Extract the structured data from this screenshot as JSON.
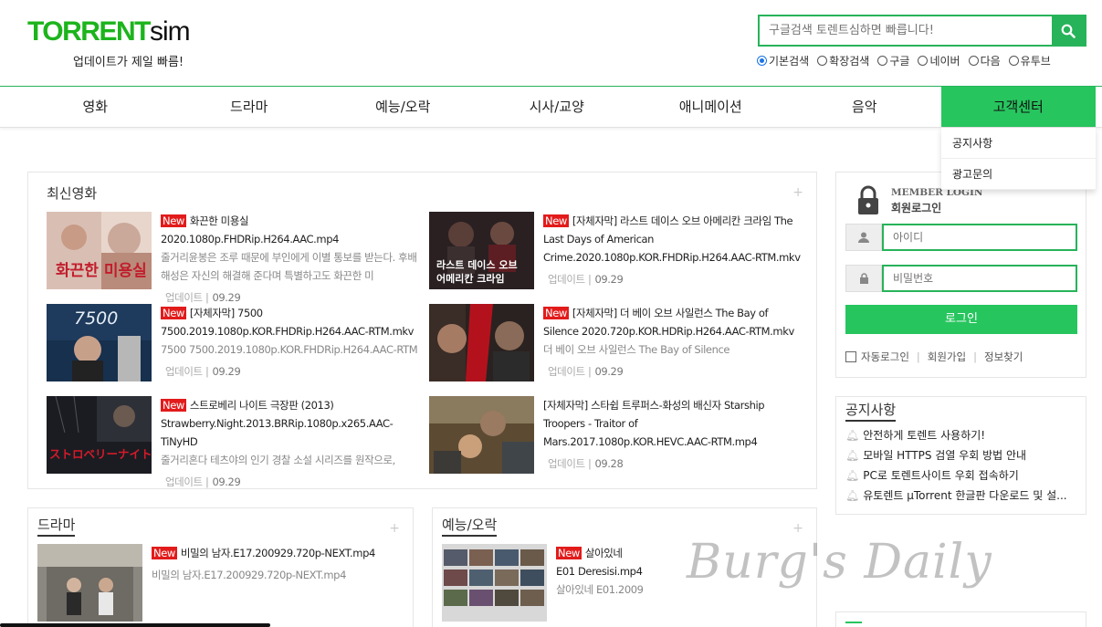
{
  "logo": {
    "part1": "TORRENT",
    "part2": "sim"
  },
  "tagline": "업데이트가 제일 빠름!",
  "search": {
    "placeholder": "구글검색 토렌트심하면 빠릅니다!"
  },
  "search_options": [
    {
      "label": "기본검색",
      "checked": true
    },
    {
      "label": "확장검색",
      "checked": false
    },
    {
      "label": "구글",
      "checked": false
    },
    {
      "label": "네이버",
      "checked": false
    },
    {
      "label": "다음",
      "checked": false
    },
    {
      "label": "유투브",
      "checked": false
    }
  ],
  "nav": [
    "영화",
    "드라마",
    "예능/오락",
    "시사/교양",
    "애니메이션",
    "음악",
    "고객센터"
  ],
  "dropdown": [
    "공지사항",
    "광고문의"
  ],
  "latest": {
    "title": "최신영화",
    "plus": "+",
    "items": [
      {
        "new": "New",
        "title": "화끈한 미용실 2020.1080p.FHDRip.H264.AAC.mp4",
        "desc": "줄거리윤봉은 조루 때문에 부인에게 이별 통보를 받는다. 후배 해성은 자신의 해결해 준다며 특별하고도 화끈한 미",
        "meta": "업데이트 |",
        "date": "09.29"
      },
      {
        "new": "New",
        "title": "[자체자막] 라스트 데이스 오브 아메리칸 크라임 The Last Days of American Crime.2020.1080p.KOR.FHDRip.H264.AAC-RTM.mkv",
        "desc": "",
        "meta": "업데이트 |",
        "date": "09.29"
      },
      {
        "new": "New",
        "title": "[자체자막] 7500 7500.2019.1080p.KOR.FHDRip.H264.AAC-RTM.mkv",
        "desc": "7500 7500.2019.1080p.KOR.FHDRip.H264.AAC-RTM",
        "meta": "업데이트 |",
        "date": "09.29"
      },
      {
        "new": "New",
        "title": "[자체자막] 더 베이 오브 사일런스 The Bay of Silence 2020.720p.KOR.HDRip.H264.AAC-RTM.mkv",
        "desc": "더 베이 오브 사일런스 The Bay of Silence",
        "meta": "업데이트 |",
        "date": "09.29"
      },
      {
        "new": "New",
        "title": "스트로베리 나이트 극장판 (2013) Strawberry.Night.2013.BRRip.1080p.x265.AAC-TiNyHD",
        "desc": "줄거리혼다 테츠야의 인기 경찰 소설 시리즈를 원작으로,",
        "meta": "업데이트 |",
        "date": "09.29"
      },
      {
        "new": "",
        "title": "[자체자막] 스타쉽 트루퍼스-화성의 배신자 Starship Troopers - Traitor of Mars.2017.1080p.KOR.HEVC.AAC-RTM.mp4",
        "desc": "",
        "meta": "업데이트 |",
        "date": "09.28"
      }
    ]
  },
  "drama": {
    "title": "드라마",
    "plus": "+",
    "item": {
      "new": "New",
      "title": "비밀의 남자.E17.200929.720p-NEXT.mp4",
      "desc": "비밀의 남자.E17.200929.720p-NEXT.mp4"
    }
  },
  "variety": {
    "title": "예능/오락",
    "plus": "+",
    "item": {
      "new": "New",
      "title": "살아있네 E01 Deresisi.mp4",
      "desc": "살아있네 E01.20092"
    }
  },
  "thumb_text": {
    "t1": "화끈한 미용실",
    "t2": "라스트 데이스 오브",
    "t2b": "어메리칸 크라임",
    "t3": "7500",
    "t5": "ストロベリーナイト"
  },
  "login": {
    "title_en": "MEMBER LOGIN",
    "title_ko": "회원로그인",
    "id_placeholder": "아이디",
    "pw_placeholder": "비밀번호",
    "button": "로그인",
    "auto": "자동로그인",
    "join": "회원가입",
    "find": "정보찾기"
  },
  "notice": {
    "title": "공지사항",
    "items": [
      "안전하게 토렌트 사용하기!",
      "모바일 HTTPS 검열 우회 방법 안내",
      "PC로 토렌트사이트 우회 접속하기",
      "유토렌트 µTorrent 한글판 다운로드 및 설..."
    ]
  },
  "watermark": "Burg's Daily",
  "colors": {
    "brand": "#27c55e",
    "new_badge": "#e21b1b"
  }
}
